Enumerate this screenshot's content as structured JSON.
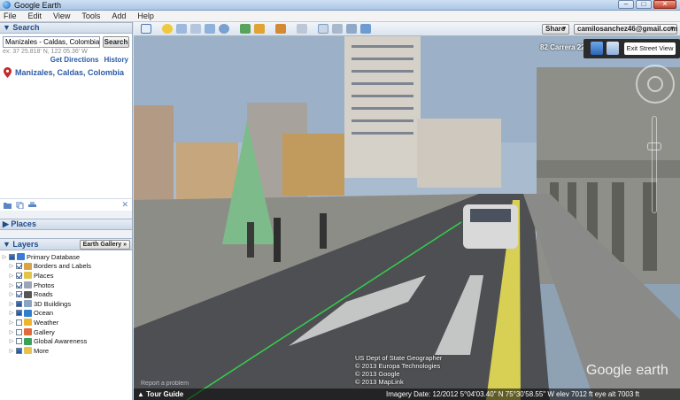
{
  "window": {
    "title": "Google Earth",
    "controls": [
      "–",
      "□",
      "✕"
    ]
  },
  "menu": [
    "File",
    "Edit",
    "View",
    "Tools",
    "Add",
    "Help"
  ],
  "search": {
    "header": "Search",
    "input_value": "Manizales - Caldas, Colombia",
    "button": "Search",
    "example": "ex: 37 25.818' N, 122 05.36' W",
    "get_directions": "Get Directions",
    "history": "History",
    "result": "Manizales, Caldas, Colombia"
  },
  "places": {
    "header": "Places"
  },
  "layers": {
    "header": "Layers",
    "earth_gallery": "Earth Gallery »",
    "items": [
      {
        "label": "Primary Database",
        "checked": "partial",
        "icon": "globe-icon",
        "icon_color": "#3a7bd5"
      },
      {
        "label": "Borders and Labels",
        "checked": "on",
        "icon": "borders-icon",
        "icon_color": "#d9a441"
      },
      {
        "label": "Places",
        "checked": "on",
        "icon": "places-icon",
        "icon_color": "#e3c34b"
      },
      {
        "label": "Photos",
        "checked": "on",
        "icon": "photos-icon",
        "icon_color": "#9aa6b6"
      },
      {
        "label": "Roads",
        "checked": "on",
        "icon": "roads-icon",
        "icon_color": "#555555"
      },
      {
        "label": "3D Buildings",
        "checked": "partial",
        "icon": "buildings-icon",
        "icon_color": "#8aa4c4"
      },
      {
        "label": "Ocean",
        "checked": "partial",
        "icon": "ocean-icon",
        "icon_color": "#2f7fd1"
      },
      {
        "label": "Weather",
        "checked": "off",
        "icon": "weather-icon",
        "icon_color": "#f0b429"
      },
      {
        "label": "Gallery",
        "checked": "off",
        "icon": "gallery-icon",
        "icon_color": "#e06a3a"
      },
      {
        "label": "Global Awareness",
        "checked": "off",
        "icon": "awareness-icon",
        "icon_color": "#3aa05a"
      },
      {
        "label": "More",
        "checked": "partial",
        "icon": "folder-icon",
        "icon_color": "#e8c24f"
      }
    ]
  },
  "toolbar": {
    "share": "Share",
    "account": "camilosanchez46@gmail.com"
  },
  "streetview": {
    "street_name": "82 Carrera 22",
    "exit_label": "Exit Street View",
    "attribution": [
      "US Dept of State Geographer",
      "© 2013 Europa Technologies",
      "© 2013 Google",
      "© 2013 MapLink"
    ],
    "logo_google": "Google",
    "logo_earth": "earth",
    "report": "Report a problem",
    "tour_guide": "Tour Guide",
    "status": "Imagery Date: 12/2012      5°04'03.40\" N   75°30'58.55\" W  elev  7012 ft      eye alt  7003 ft"
  }
}
